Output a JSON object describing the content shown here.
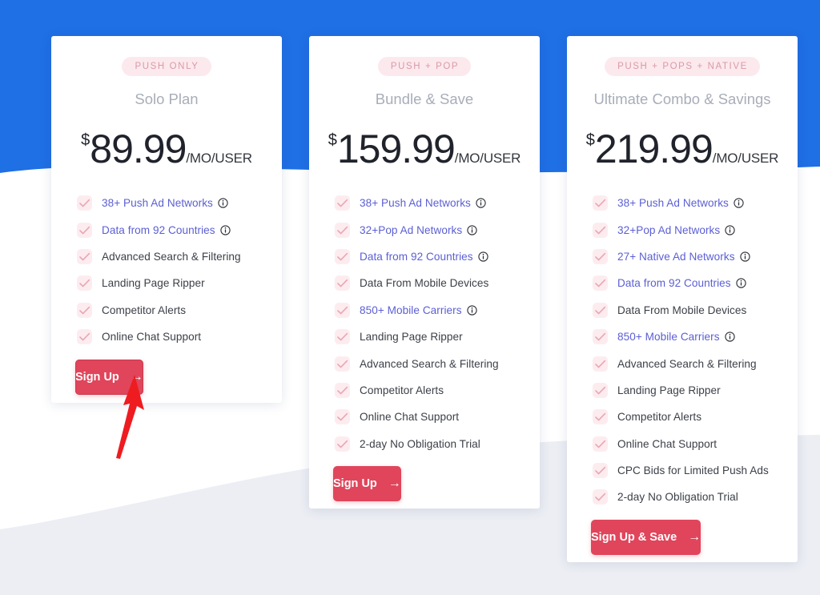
{
  "theme": {
    "background_blue": "#1f6fe5",
    "cta_red": "#e0455b",
    "badge_bg": "#fce9ed",
    "badge_text": "#d99aa9",
    "link_text": "#5b5fd4",
    "annotation_red": "#ee1c20"
  },
  "plans": [
    {
      "badge": "PUSH ONLY",
      "name": "Solo Plan",
      "currency": "$",
      "amount": "89.99",
      "period": "/MO/USER",
      "cta": "Sign Up",
      "cta_arrow": "→",
      "features": [
        {
          "label": "38+ Push Ad Networks",
          "link": true,
          "info": true
        },
        {
          "label": "Data from 92 Countries",
          "link": true,
          "info": true
        },
        {
          "label": "Advanced Search & Filtering",
          "link": false,
          "info": false
        },
        {
          "label": "Landing Page Ripper",
          "link": false,
          "info": false
        },
        {
          "label": "Competitor Alerts",
          "link": false,
          "info": false
        },
        {
          "label": "Online Chat Support",
          "link": false,
          "info": false
        }
      ]
    },
    {
      "badge": "PUSH + POP",
      "name": "Bundle & Save",
      "currency": "$",
      "amount": "159.99",
      "period": "/MO/USER",
      "cta": "Sign Up",
      "cta_arrow": "→",
      "features": [
        {
          "label": "38+ Push Ad Networks",
          "link": true,
          "info": true
        },
        {
          "label": "32+Pop Ad Networks",
          "link": true,
          "info": true
        },
        {
          "label": "Data from 92 Countries",
          "link": true,
          "info": true
        },
        {
          "label": "Data From Mobile Devices",
          "link": false,
          "info": false
        },
        {
          "label": "850+ Mobile Carriers",
          "link": true,
          "info": true
        },
        {
          "label": "Landing Page Ripper",
          "link": false,
          "info": false
        },
        {
          "label": "Advanced Search & Filtering",
          "link": false,
          "info": false
        },
        {
          "label": "Competitor Alerts",
          "link": false,
          "info": false
        },
        {
          "label": "Online Chat Support",
          "link": false,
          "info": false
        },
        {
          "label": "2-day No Obligation Trial",
          "link": false,
          "info": false
        }
      ]
    },
    {
      "badge": "PUSH + POPS + NATIVE",
      "name": "Ultimate Combo & Savings",
      "currency": "$",
      "amount": "219.99",
      "period": "/MO/USER",
      "cta": "Sign Up & Save",
      "cta_arrow": "→",
      "features": [
        {
          "label": "38+ Push Ad Networks",
          "link": true,
          "info": true
        },
        {
          "label": "32+Pop Ad Networks",
          "link": true,
          "info": true
        },
        {
          "label": "27+ Native Ad Networks",
          "link": true,
          "info": true
        },
        {
          "label": "Data from 92 Countries",
          "link": true,
          "info": true
        },
        {
          "label": "Data From Mobile Devices",
          "link": false,
          "info": false
        },
        {
          "label": "850+ Mobile Carriers",
          "link": true,
          "info": true
        },
        {
          "label": "Advanced Search & Filtering",
          "link": false,
          "info": false
        },
        {
          "label": "Landing Page Ripper",
          "link": false,
          "info": false
        },
        {
          "label": "Competitor Alerts",
          "link": false,
          "info": false
        },
        {
          "label": "Online Chat Support",
          "link": false,
          "info": false
        },
        {
          "label": "CPC Bids for Limited Push Ads",
          "link": false,
          "info": false
        },
        {
          "label": "2-day No Obligation Trial",
          "link": false,
          "info": false
        }
      ]
    }
  ],
  "annotation": {
    "icon": "arrow-up-pointer",
    "target": "Sign Up"
  }
}
